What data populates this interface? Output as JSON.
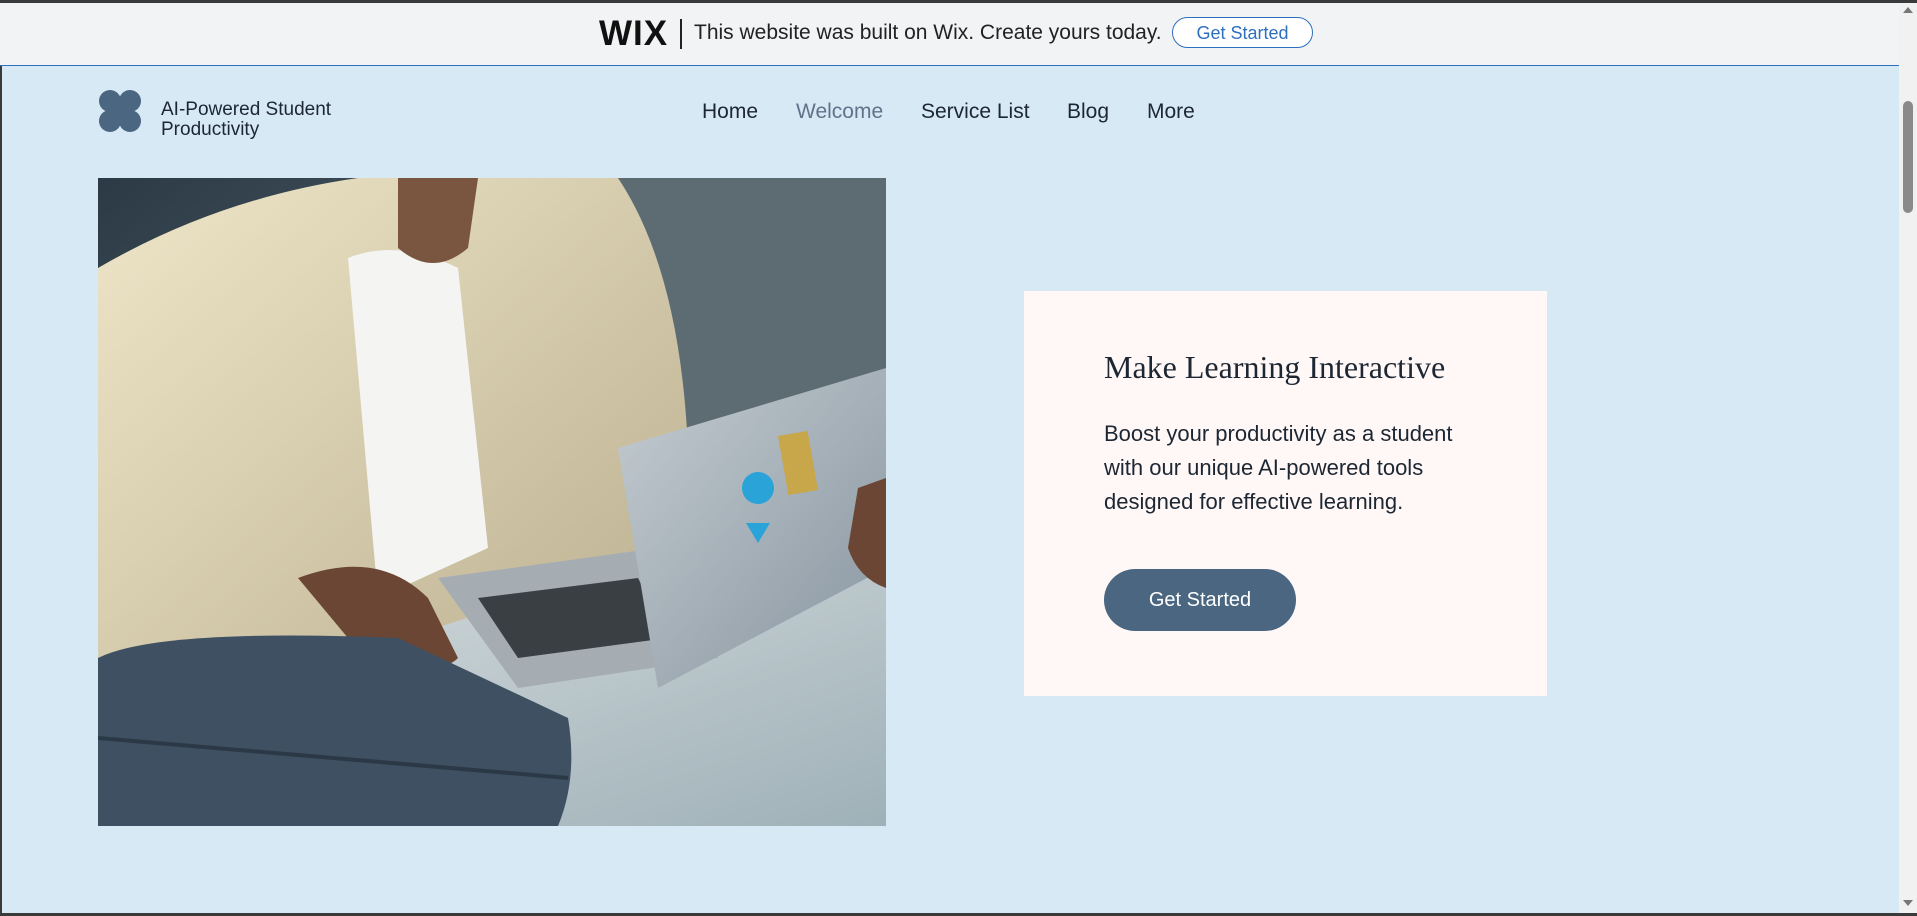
{
  "wix_banner": {
    "logo": "WIX",
    "message": "This website was built on Wix. Create yours today.",
    "button_label": "Get Started"
  },
  "header": {
    "site_title_line1": "AI-Powered Student",
    "site_title_line2": "Productivity",
    "nav": [
      {
        "label": "Home",
        "active": false
      },
      {
        "label": "Welcome",
        "active": true
      },
      {
        "label": "Service List",
        "active": false
      },
      {
        "label": "Blog",
        "active": false
      },
      {
        "label": "More",
        "active": false
      }
    ]
  },
  "hero": {
    "image_icon": "student-laptop-photo",
    "card_title": "Make Learning Interactive",
    "card_body": "Boost your productivity as a student with our unique AI-powered tools designed for effective learning.",
    "button_label": "Get Started"
  },
  "colors": {
    "page_bg": "#d8e9f6",
    "accent": "#4a6680",
    "wix_blue": "#2f6fbf",
    "card_bg": "#fff8f7"
  }
}
